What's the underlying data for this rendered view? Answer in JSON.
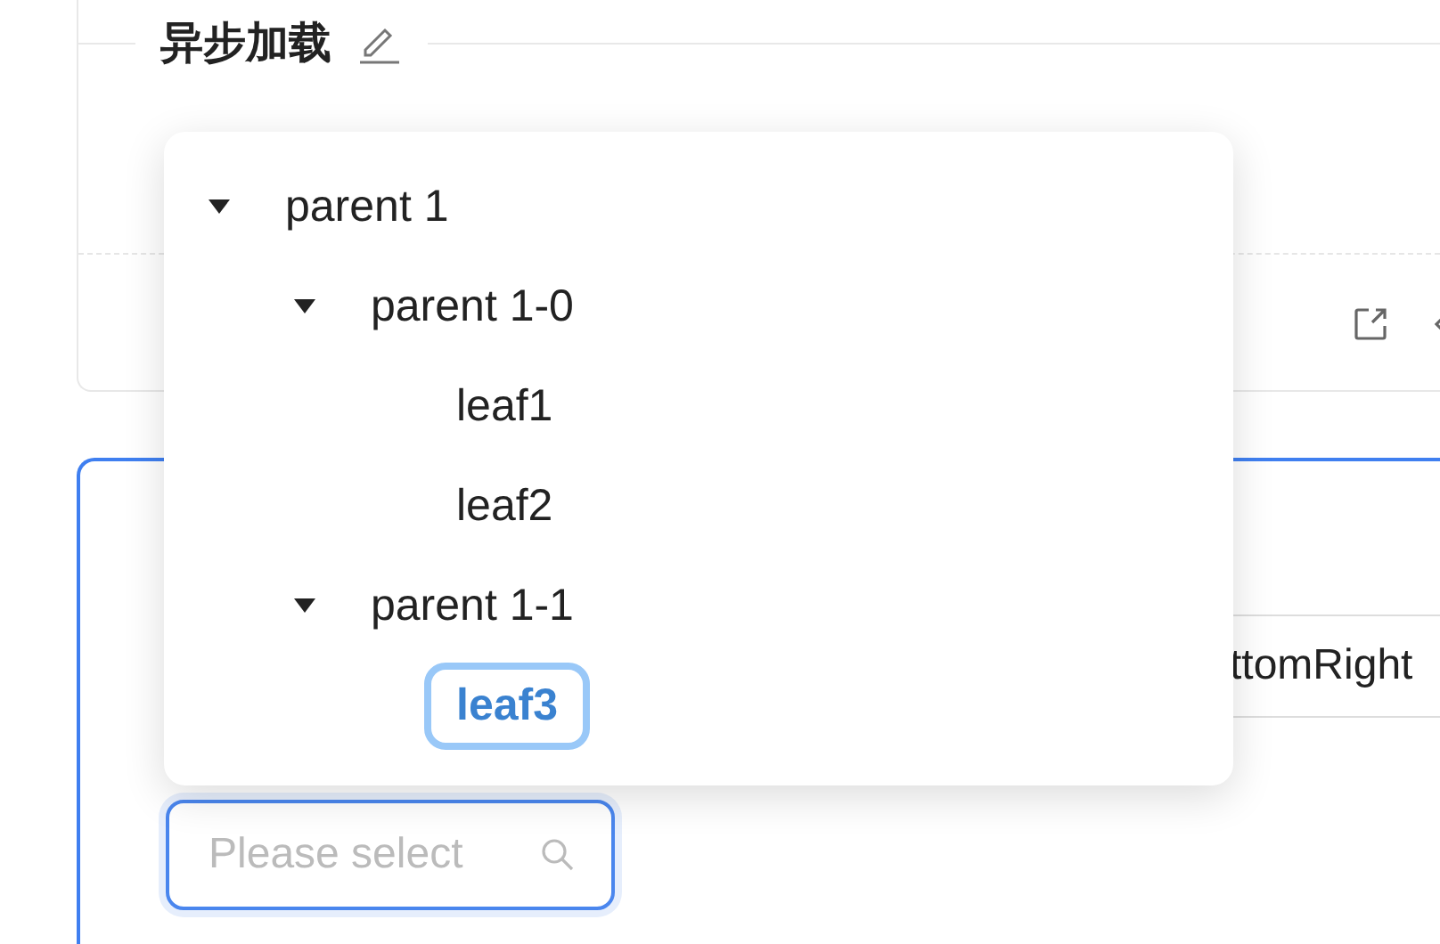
{
  "section_title": "异步加载",
  "toolbar_partial_text": "ttomRight",
  "select": {
    "placeholder": "Please select"
  },
  "tree": [
    {
      "label": "parent 1",
      "expanded": true,
      "selected": false,
      "children": [
        {
          "label": "parent 1-0",
          "expanded": true,
          "selected": false,
          "children": [
            {
              "label": "leaf1",
              "selected": false
            },
            {
              "label": "leaf2",
              "selected": false
            }
          ]
        },
        {
          "label": "parent 1-1",
          "expanded": true,
          "selected": false,
          "children": [
            {
              "label": "leaf3",
              "selected": true
            }
          ]
        }
      ]
    }
  ]
}
